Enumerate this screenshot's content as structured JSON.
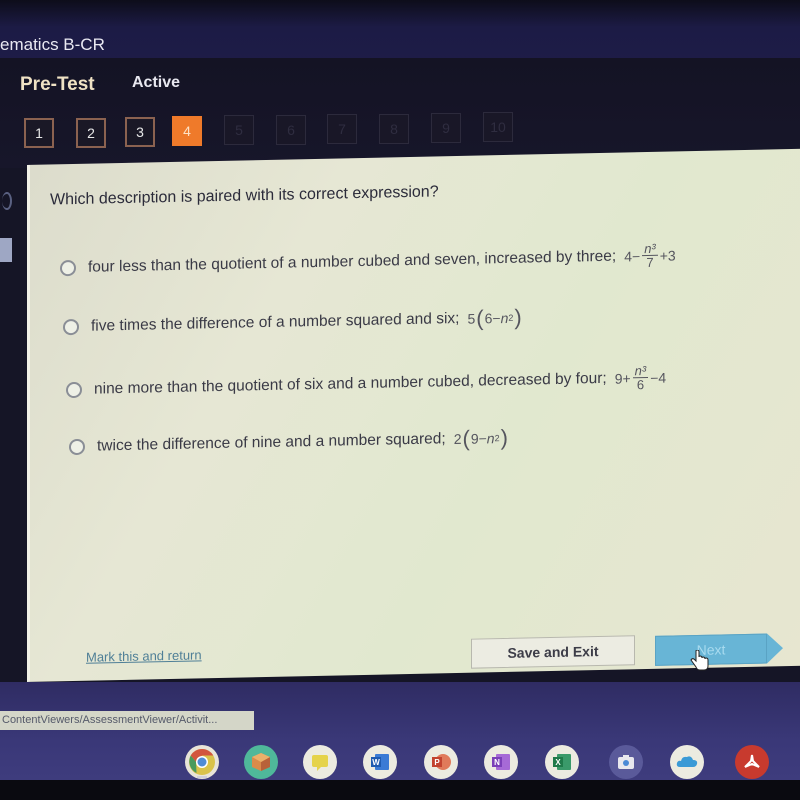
{
  "header": {
    "course_title": "ematics B-CR",
    "test_name": "Pre-Test",
    "status": "Active"
  },
  "question_nav": {
    "current": 4,
    "items": [
      {
        "label": "1",
        "state": "answered"
      },
      {
        "label": "2",
        "state": "answered"
      },
      {
        "label": "3",
        "state": "answered"
      },
      {
        "label": "4",
        "state": "current"
      },
      {
        "label": "5",
        "state": "locked"
      },
      {
        "label": "6",
        "state": "locked"
      },
      {
        "label": "7",
        "state": "locked"
      },
      {
        "label": "8",
        "state": "locked"
      },
      {
        "label": "9",
        "state": "locked"
      },
      {
        "label": "10",
        "state": "locked"
      }
    ]
  },
  "question": {
    "prompt": "Which description is paired with its correct expression?",
    "choices": [
      {
        "text": "four less than the quotient of a number cubed and seven, increased by three;",
        "expr": {
          "pre": "4−",
          "num": "n³",
          "den": "7",
          "post": "+3"
        }
      },
      {
        "text": "five times the difference of a number squared and six;",
        "expr": {
          "coef": "5",
          "inner": "6−",
          "var": "n",
          "exp": "2"
        }
      },
      {
        "text": "nine more than the quotient of six and a number cubed, decreased by four;",
        "expr": {
          "pre": "9+",
          "num": "n³",
          "den": "6",
          "post": "−4"
        }
      },
      {
        "text": "twice the difference of nine and a number squared;",
        "expr": {
          "coef": "2",
          "inner": "9−",
          "var": "n",
          "exp": "2"
        }
      }
    ]
  },
  "footer": {
    "mark_link": "Mark this and return",
    "save_exit": "Save and Exit",
    "next": "Next"
  },
  "status_url": "ContentViewers/AssessmentViewer/Activit...",
  "shelf": {
    "apps": [
      "chrome",
      "3d-box",
      "keep",
      "word",
      "powerpoint",
      "onenote",
      "excel",
      "camera",
      "onedrive",
      "acrobat"
    ]
  },
  "colors": {
    "current_question": "#ef7a2a",
    "next_button": "#68b5d6",
    "link": "#4f7f97"
  }
}
